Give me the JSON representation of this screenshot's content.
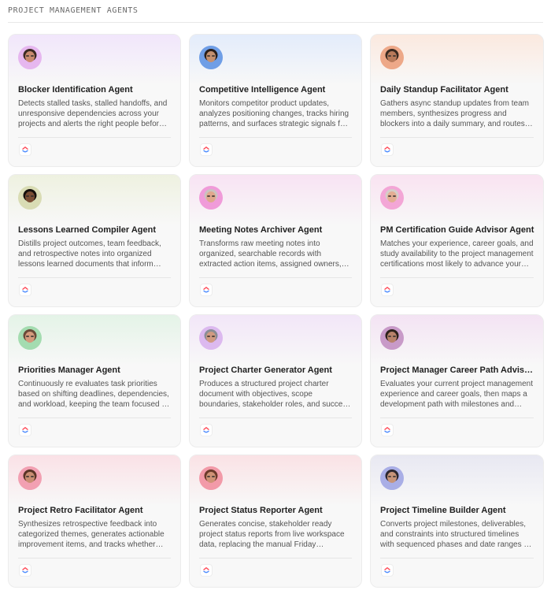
{
  "section": {
    "title": "PROJECT MANAGEMENT AGENTS"
  },
  "cards": [
    {
      "title": "Blocker Identification Agent",
      "description": "Detects stalled tasks, stalled handoffs, and unresponsive dependencies across your projects and alerts the right people before they slow delivery.",
      "tint": "#f1e6fb",
      "avatar": {
        "bg": "#e6b7ef",
        "skin": "#c98a6f",
        "hair": "#3b2a22"
      }
    },
    {
      "title": "Competitive Intelligence Agent",
      "description": "Monitors competitor product updates, analyzes positioning changes, tracks hiring patterns, and surfaces strategic signals for your team.",
      "tint": "#e3ecfb",
      "avatar": {
        "bg": "#6f9ee6",
        "skin": "#c4906f",
        "hair": "#2a1f1a"
      }
    },
    {
      "title": "Daily Standup Facilitator Agent",
      "description": "Gathers async standup updates from team members, synthesizes progress and blockers into a daily summary, and routes them to your channels.",
      "tint": "#fbe9df",
      "avatar": {
        "bg": "#eda888",
        "skin": "#b87a5a",
        "hair": "#3a2a20"
      }
    },
    {
      "title": "Lessons Learned Compiler Agent",
      "description": "Distills project outcomes, team feedback, and retrospective notes into organized lessons learned documents that inform future projects.",
      "tint": "#eef1e0",
      "avatar": {
        "bg": "#d9dcb4",
        "skin": "#7a4e34",
        "hair": "#15100c"
      }
    },
    {
      "title": "Meeting Notes Archiver Agent",
      "description": "Transforms raw meeting notes into organized, searchable records with extracted action items, assigned owners, and due dates.",
      "tint": "#f8e3f3",
      "avatar": {
        "bg": "#f09bd9",
        "skin": "#e0a78d",
        "hair": "#c9c2c0"
      }
    },
    {
      "title": "PM Certification Guide Advisor Agent",
      "description": "Matches your experience, career goals, and study availability to the project management certifications most likely to advance your career.",
      "tint": "#f9e3f1",
      "avatar": {
        "bg": "#f3a6d6",
        "skin": "#e3ad93",
        "hair": "#d4cdc8"
      }
    },
    {
      "title": "Priorities Manager Agent",
      "description": "Continuously re evaluates task priorities based on shifting deadlines, dependencies, and workload, keeping the team focused on what matters.",
      "tint": "#e4f3e7",
      "avatar": {
        "bg": "#a4dcb0",
        "skin": "#d49a7c",
        "hair": "#6a4a38"
      }
    },
    {
      "title": "Project Charter Generator Agent",
      "description": "Produces a structured project charter document with objectives, scope boundaries, stakeholder roles, and success criteria.",
      "tint": "#f2e6f8",
      "avatar": {
        "bg": "#dcb9ef",
        "skin": "#d09a82",
        "hair": "#8a8e96"
      }
    },
    {
      "title": "Project Manager Career Path Advisor Agent",
      "description": "Evaluates your current project management experience and career goals, then maps a development path with milestones and resources.",
      "tint": "#f3e3f3",
      "avatar": {
        "bg": "#c89ac8",
        "skin": "#b8826a",
        "hair": "#2e221c"
      }
    },
    {
      "title": "Project Retro Facilitator Agent",
      "description": "Synthesizes retrospective feedback into categorized themes, generates actionable improvement items, and tracks whether they get done.",
      "tint": "#fae1e6",
      "avatar": {
        "bg": "#f2a0b2",
        "skin": "#c98d72",
        "hair": "#5a3426"
      }
    },
    {
      "title": "Project Status Reporter Agent",
      "description": "Generates concise, stakeholder ready project status reports from live workspace data, replacing the manual Friday scramble.",
      "tint": "#fae2e5",
      "avatar": {
        "bg": "#f29aa8",
        "skin": "#cf9276",
        "hair": "#6b3a2a"
      }
    },
    {
      "title": "Project Timeline Builder Agent",
      "description": "Converts project milestones, deliverables, and constraints into structured timelines with sequenced phases and date ranges for review.",
      "tint": "#e8e8f2",
      "avatar": {
        "bg": "#a9aee6",
        "skin": "#c79479",
        "hair": "#2d2830"
      }
    }
  ],
  "icons": {
    "avatar": "agent-avatar-icon",
    "logo": "clickup-logo-icon"
  },
  "colors": {
    "logo_blue": "#4e8cff",
    "logo_red": "#ff4e5b",
    "logo_orange": "#ffa12f"
  }
}
